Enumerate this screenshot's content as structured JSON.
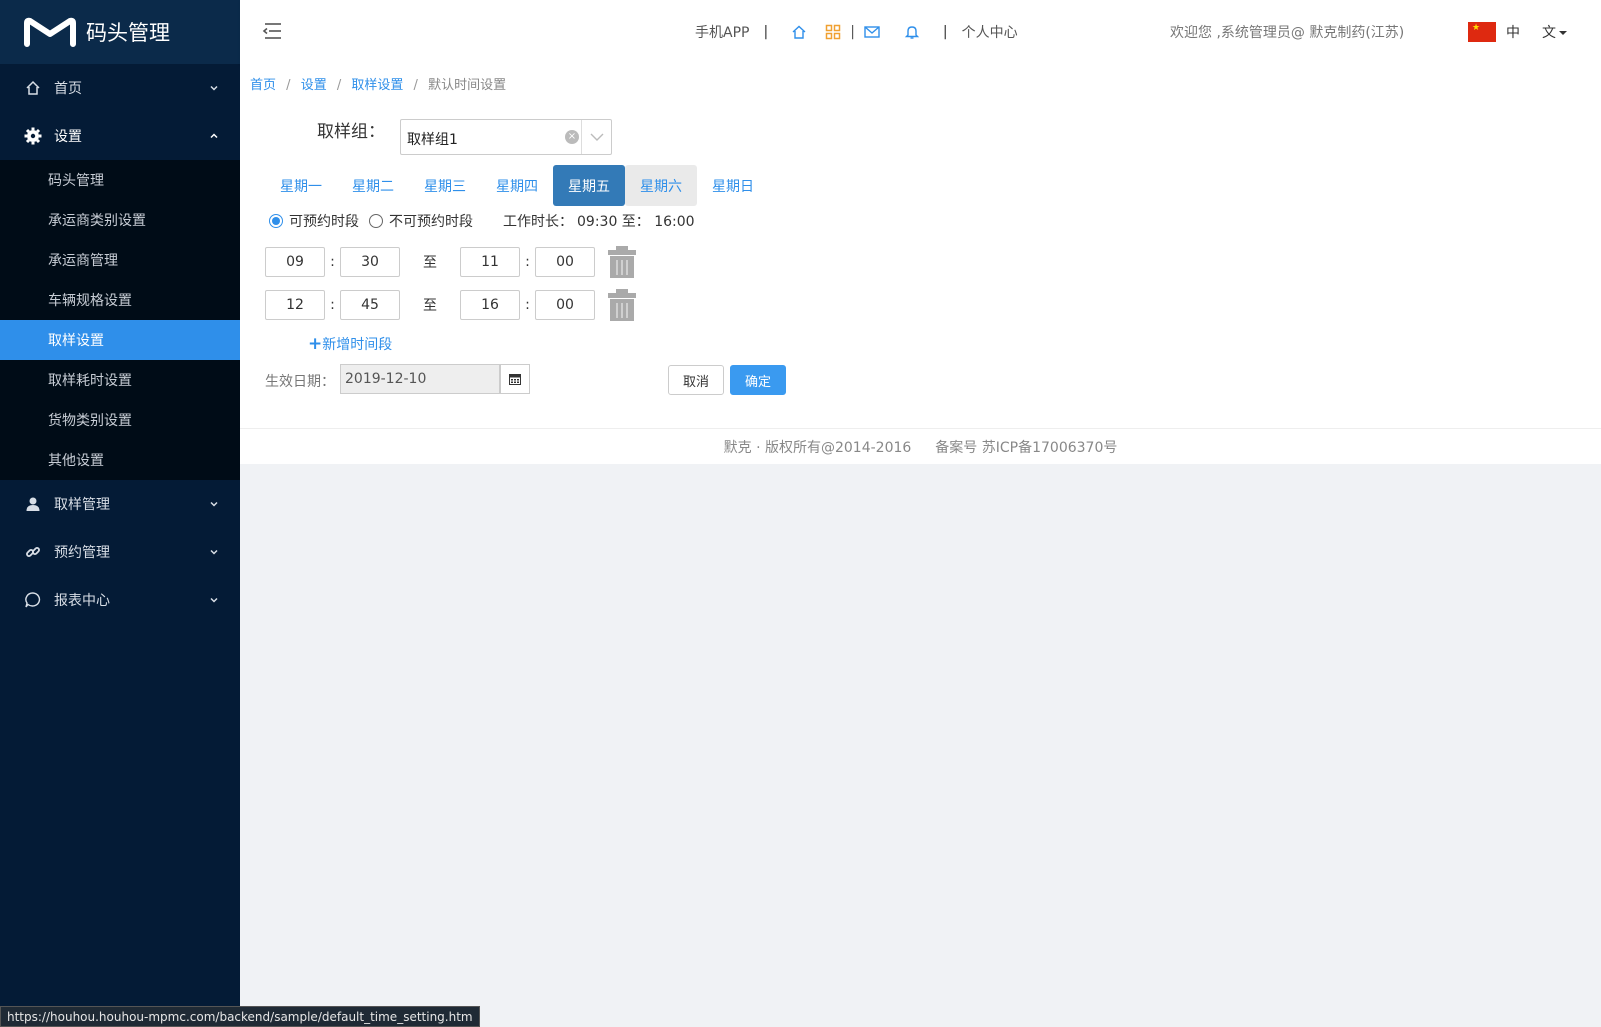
{
  "app": {
    "logo_text": "码头管理"
  },
  "sidebar": {
    "menu": [
      {
        "label": "首页",
        "icon": "home-icon"
      },
      {
        "label": "设置",
        "icon": "gear-icon"
      },
      {
        "label": "取样管理",
        "icon": "user-icon"
      },
      {
        "label": "预约管理",
        "icon": "link-icon"
      },
      {
        "label": "报表中心",
        "icon": "chat-bubble-icon"
      }
    ],
    "submenu": [
      {
        "label": "码头管理"
      },
      {
        "label": "承运商类别设置"
      },
      {
        "label": "承运商管理"
      },
      {
        "label": "车辆规格设置"
      },
      {
        "label": "取样设置",
        "active": true
      },
      {
        "label": "取样耗时设置"
      },
      {
        "label": "货物类别设置"
      },
      {
        "label": "其他设置"
      }
    ]
  },
  "header": {
    "mobile_app": "手机APP",
    "personal_center": "个人中心",
    "welcome": "欢迎您 ,系统管理员@ 默克制药(江苏)",
    "lang_zh": "中",
    "lang_wen": "文",
    "separator": "|"
  },
  "breadcrumb": {
    "home": "首页",
    "settings": "设置",
    "sample_settings": "取样设置",
    "current": "默认时间设置",
    "sep": "/"
  },
  "form": {
    "group_label": "取样组：",
    "group_value": "取样组1",
    "days": [
      "星期一",
      "星期二",
      "星期三",
      "星期四",
      "星期五",
      "星期六",
      "星期日"
    ],
    "active_day": "星期五",
    "radio_available": "可预约时段",
    "radio_unavailable": "不可预约时段",
    "worktime_label": "工作时长：",
    "worktime_value": "09:30 至： 16:00",
    "to_label": "至",
    "colon": ":",
    "slots": [
      {
        "start_h": "09",
        "start_m": "30",
        "end_h": "11",
        "end_m": "00"
      },
      {
        "start_h": "12",
        "start_m": "45",
        "end_h": "16",
        "end_m": "00"
      }
    ],
    "add_slot": "新增时间段",
    "effective_label": "生效日期：",
    "effective_date": "2019-12-10",
    "cancel": "取消",
    "confirm": "确定"
  },
  "footer": {
    "copyright": "默克 · 版权所有@2014-2016",
    "icp": "备案号 苏ICP备17006370号"
  },
  "statusbar": {
    "url": "https://houhou.houhou-mpmc.com/backend/sample/default_time_setting.htm"
  },
  "colors": {
    "sidebar_bg": "#041b36",
    "accent": "#2f8fea",
    "active_tab": "#337ab7"
  }
}
